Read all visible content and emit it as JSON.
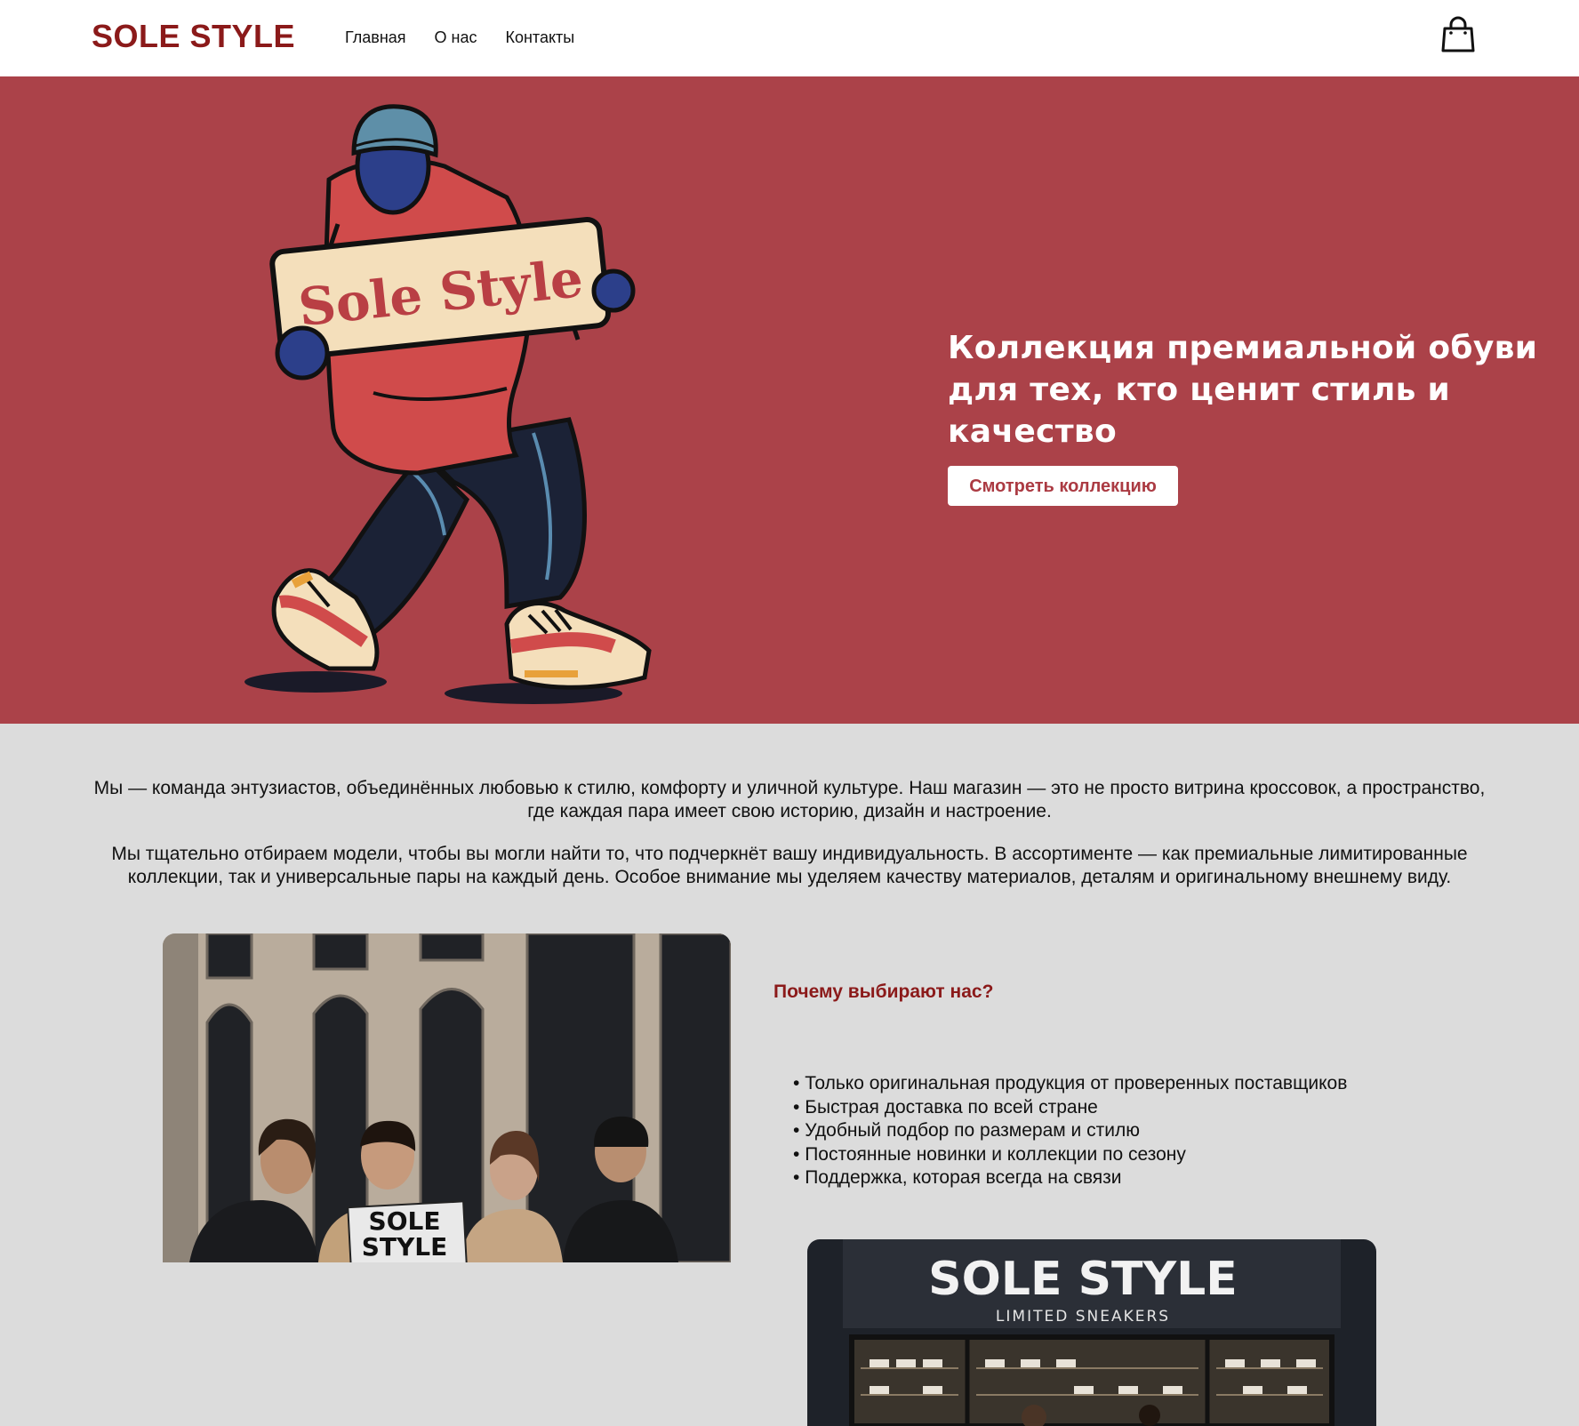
{
  "header": {
    "logo": "SOLE STYLE",
    "nav": [
      "Главная",
      "О нас",
      "Контакты"
    ]
  },
  "hero": {
    "sign_text": "Sole Style",
    "title": "Коллекция премиальной обуви для тех, кто ценит стиль и качество",
    "cta": "Смотреть коллекцию"
  },
  "about": {
    "paragraph1": "Мы — команда энтузиастов, объединённых любовью к стилю, комфорту и уличной культуре. Наш магазин — это не просто витрина кроссовок, а пространство, где каждая пара имеет свою историю, дизайн и настроение.",
    "paragraph2": "Мы тщательно отбираем модели, чтобы вы могли найти то, что подчеркнёт вашу индивидуальность. В ассортименте — как премиальные лимитированные коллекции, так и универсальные пары на каждый день. Особое внимание мы уделяем качеству материалов, деталям и оригинальному внешнему виду.",
    "why_title": "Почему выбирают нас?",
    "why_items": [
      "Только оригинальная продукция от проверенных поставщиков",
      "Быстрая доставка по всей стране",
      "Удобный подбор по размерам и стилю",
      "Постоянные новинки и коллекции по сезону",
      "Поддержка, которая всегда на связи"
    ],
    "photo1_sign": [
      "SOLE",
      "STYLE"
    ],
    "store_sign": "SOLE STYLE",
    "store_subsign": "LIMITED SNEAKERS"
  },
  "colors": {
    "brand": "#8b1a1a",
    "hero_bg": "#ab4249",
    "page_bg": "#dcdcdc"
  }
}
